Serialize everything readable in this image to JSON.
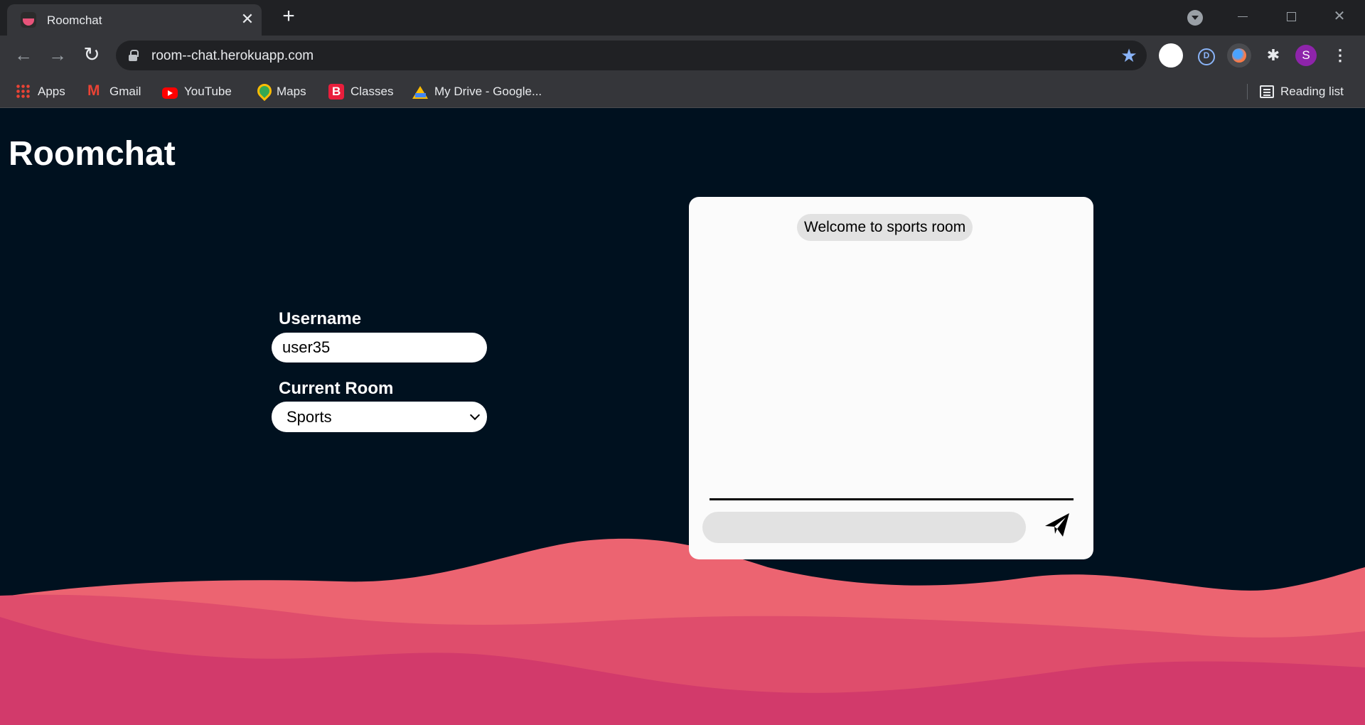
{
  "browser": {
    "tab_title": "Roomchat",
    "tab_close": "✕",
    "new_tab": "+",
    "url": "room--chat.herokuapp.com",
    "star": "★",
    "profile_initial": "S",
    "menu": "⋮",
    "extensions": "✱"
  },
  "bookmarks": {
    "items": [
      {
        "label": "Apps",
        "icon": "apps-icon"
      },
      {
        "label": "Gmail",
        "icon": "gmail-icon"
      },
      {
        "label": "YouTube",
        "icon": "youtube-icon"
      },
      {
        "label": "Maps",
        "icon": "maps-icon"
      },
      {
        "label": "Classes",
        "icon": "classes-icon"
      },
      {
        "label": "My Drive - Google...",
        "icon": "drive-icon"
      }
    ],
    "reading_list": "Reading list"
  },
  "page": {
    "title": "Roomchat",
    "username_label": "Username",
    "username_value": "user35",
    "room_label": "Current Room",
    "room_value": "Sports"
  },
  "chat": {
    "messages": [
      "Welcome to sports room"
    ],
    "message_placeholder": ""
  },
  "colors": {
    "background": "#00111f",
    "wave_1": "#ec6471",
    "wave_2": "#df4d6c",
    "wave_3": "#d23a6b"
  }
}
